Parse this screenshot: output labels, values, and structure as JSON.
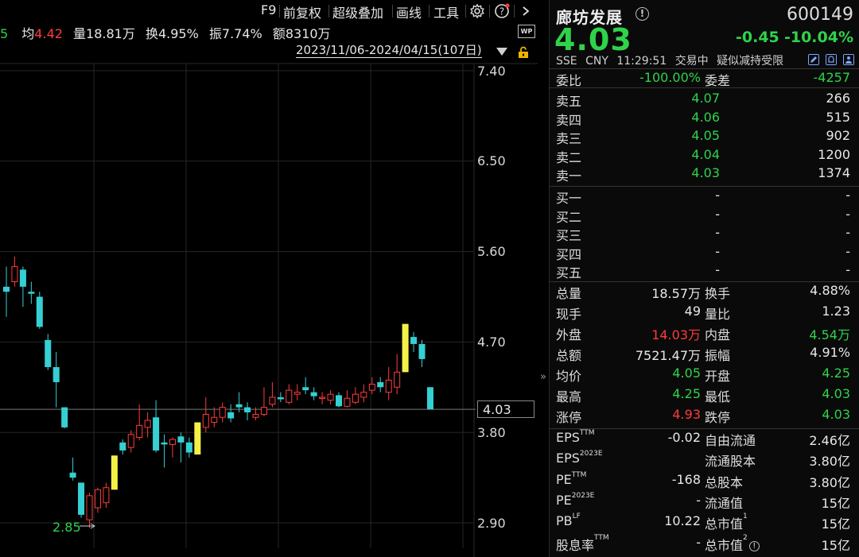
{
  "toolbar": {
    "f9": "F9",
    "fuquan": "前复权",
    "superimpose": "超级叠加",
    "drawing": "画线",
    "tools": "工具",
    "wp": "WP"
  },
  "stats": {
    "prefix": "5",
    "avg_label": "均",
    "avg_value": "4.42",
    "vol_label": "量",
    "vol_value": "18.81万",
    "turnover_label": "换",
    "turnover_value": "4.95%",
    "amplitude_label": "振",
    "amplitude_value": "7.74%",
    "amount_label": "额",
    "amount_value": "8310万"
  },
  "date_range": "2023/11/06-2024/04/15(107日)",
  "price_axis": [
    "7.40",
    "6.50",
    "5.60",
    "4.70",
    "3.80",
    "2.90"
  ],
  "last_price_tag": "4.03",
  "low_marker": "2.85",
  "collapse_glyph": "»",
  "colors": {
    "up": "#ff3b3b",
    "down": "#35d0d3",
    "limit_up": "#f4f247",
    "green": "#2fd34a",
    "background": "#000000"
  },
  "chart_data": {
    "type": "candlestick",
    "ylim": [
      2.78,
      7.55
    ],
    "grid": true,
    "candles": [
      {
        "o": 5.25,
        "c": 5.2,
        "h": 5.45,
        "l": 4.95,
        "k": "down"
      },
      {
        "o": 5.3,
        "c": 5.45,
        "h": 5.55,
        "l": 5.25,
        "k": "up"
      },
      {
        "o": 5.42,
        "c": 5.25,
        "h": 5.45,
        "l": 5.05,
        "k": "down"
      },
      {
        "o": 5.2,
        "c": 5.18,
        "h": 5.3,
        "l": 5.08,
        "k": "down"
      },
      {
        "o": 5.15,
        "c": 4.85,
        "h": 5.2,
        "l": 4.83,
        "k": "down"
      },
      {
        "o": 4.72,
        "c": 4.45,
        "h": 4.78,
        "l": 4.42,
        "k": "down"
      },
      {
        "o": 4.45,
        "c": 4.3,
        "h": 4.6,
        "l": 4.05,
        "k": "down"
      },
      {
        "o": 4.05,
        "c": 3.85,
        "h": 4.05,
        "l": 3.84,
        "k": "down"
      },
      {
        "o": 3.4,
        "c": 3.35,
        "h": 3.55,
        "l": 3.32,
        "k": "down"
      },
      {
        "o": 3.3,
        "c": 2.98,
        "h": 3.3,
        "l": 2.95,
        "k": "down"
      },
      {
        "o": 2.93,
        "c": 3.17,
        "h": 3.2,
        "l": 2.85,
        "k": "up"
      },
      {
        "o": 3.05,
        "c": 3.23,
        "h": 3.25,
        "l": 3.0,
        "k": "up"
      },
      {
        "o": 3.1,
        "c": 3.25,
        "h": 3.3,
        "l": 3.05,
        "k": "up"
      },
      {
        "o": 3.23,
        "c": 3.57,
        "h": 3.57,
        "l": 3.23,
        "k": "limit_up"
      },
      {
        "o": 3.7,
        "c": 3.62,
        "h": 3.73,
        "l": 3.58,
        "k": "down"
      },
      {
        "o": 3.65,
        "c": 3.78,
        "h": 3.82,
        "l": 3.6,
        "k": "up"
      },
      {
        "o": 3.75,
        "c": 3.87,
        "h": 4.08,
        "l": 3.72,
        "k": "up"
      },
      {
        "o": 3.85,
        "c": 3.92,
        "h": 4.0,
        "l": 3.75,
        "k": "up"
      },
      {
        "o": 3.95,
        "c": 3.62,
        "h": 4.12,
        "l": 3.6,
        "k": "down"
      },
      {
        "o": 3.7,
        "c": 3.68,
        "h": 3.78,
        "l": 3.45,
        "k": "down"
      },
      {
        "o": 3.68,
        "c": 3.73,
        "h": 3.75,
        "l": 3.55,
        "k": "up"
      },
      {
        "o": 3.76,
        "c": 3.7,
        "h": 3.8,
        "l": 3.5,
        "k": "down"
      },
      {
        "o": 3.7,
        "c": 3.6,
        "h": 3.75,
        "l": 3.55,
        "k": "down"
      },
      {
        "o": 3.58,
        "c": 3.9,
        "h": 3.9,
        "l": 3.58,
        "k": "limit_up"
      },
      {
        "o": 3.85,
        "c": 3.98,
        "h": 4.15,
        "l": 3.8,
        "k": "up"
      },
      {
        "o": 3.9,
        "c": 3.95,
        "h": 4.05,
        "l": 3.85,
        "k": "up"
      },
      {
        "o": 3.95,
        "c": 4.05,
        "h": 4.1,
        "l": 3.9,
        "k": "up"
      },
      {
        "o": 4.0,
        "c": 3.94,
        "h": 4.08,
        "l": 3.9,
        "k": "down"
      },
      {
        "o": 4.05,
        "c": 4.08,
        "h": 4.2,
        "l": 4.0,
        "k": "down"
      },
      {
        "o": 4.05,
        "c": 4.0,
        "h": 4.1,
        "l": 3.92,
        "k": "down"
      },
      {
        "o": 3.95,
        "c": 3.98,
        "h": 4.05,
        "l": 3.92,
        "k": "up"
      },
      {
        "o": 3.98,
        "c": 4.05,
        "h": 4.25,
        "l": 3.96,
        "k": "up"
      },
      {
        "o": 4.08,
        "c": 4.15,
        "h": 4.3,
        "l": 4.05,
        "k": "up"
      },
      {
        "o": 4.13,
        "c": 4.15,
        "h": 4.2,
        "l": 4.1,
        "k": "down"
      },
      {
        "o": 4.1,
        "c": 4.22,
        "h": 4.28,
        "l": 4.08,
        "k": "up"
      },
      {
        "o": 4.18,
        "c": 4.2,
        "h": 4.28,
        "l": 4.12,
        "k": "up"
      },
      {
        "o": 4.25,
        "c": 4.22,
        "h": 4.35,
        "l": 4.18,
        "k": "down"
      },
      {
        "o": 4.2,
        "c": 4.16,
        "h": 4.25,
        "l": 4.12,
        "k": "down"
      },
      {
        "o": 4.15,
        "c": 4.15,
        "h": 4.2,
        "l": 4.08,
        "k": "up"
      },
      {
        "o": 4.12,
        "c": 4.18,
        "h": 4.22,
        "l": 4.08,
        "k": "up"
      },
      {
        "o": 4.17,
        "c": 4.06,
        "h": 4.2,
        "l": 4.05,
        "k": "down"
      },
      {
        "o": 4.06,
        "c": 4.14,
        "h": 4.22,
        "l": 4.05,
        "k": "up"
      },
      {
        "o": 4.1,
        "c": 4.18,
        "h": 4.25,
        "l": 4.08,
        "k": "up"
      },
      {
        "o": 4.15,
        "c": 4.2,
        "h": 4.28,
        "l": 4.1,
        "k": "up"
      },
      {
        "o": 4.22,
        "c": 4.28,
        "h": 4.35,
        "l": 4.18,
        "k": "up"
      },
      {
        "o": 4.3,
        "c": 4.25,
        "h": 4.35,
        "l": 4.2,
        "k": "down"
      },
      {
        "o": 4.2,
        "c": 4.32,
        "h": 4.45,
        "l": 4.12,
        "k": "up"
      },
      {
        "o": 4.25,
        "c": 4.4,
        "h": 4.58,
        "l": 4.18,
        "k": "up"
      },
      {
        "o": 4.4,
        "c": 4.88,
        "h": 4.88,
        "l": 4.4,
        "k": "limit_up"
      },
      {
        "o": 4.75,
        "c": 4.68,
        "h": 4.8,
        "l": 4.6,
        "k": "down"
      },
      {
        "o": 4.68,
        "c": 4.53,
        "h": 4.72,
        "l": 4.45,
        "k": "down"
      },
      {
        "o": 4.25,
        "c": 4.03,
        "h": 4.25,
        "l": 4.03,
        "k": "down"
      }
    ]
  },
  "quote": {
    "name": "廊坊发展",
    "code": "600149",
    "price": "4.03",
    "change": "-0.45",
    "change_pct": "-10.04%",
    "exchange": "SSE",
    "currency": "CNY",
    "time": "11:29:51",
    "status": "交易中",
    "risk_note": "疑似减持受限",
    "weibi_label": "委比",
    "weibi_value": "-100.00%",
    "weicha_label": "委差",
    "weicha_value": "-4257",
    "asks": [
      {
        "label": "卖五",
        "price": "4.07",
        "vol": "266"
      },
      {
        "label": "卖四",
        "price": "4.06",
        "vol": "515"
      },
      {
        "label": "卖三",
        "price": "4.05",
        "vol": "902"
      },
      {
        "label": "卖二",
        "price": "4.04",
        "vol": "1200"
      },
      {
        "label": "卖一",
        "price": "4.03",
        "vol": "1374"
      }
    ],
    "bids": [
      {
        "label": "买一",
        "price": "-",
        "vol": "-"
      },
      {
        "label": "买二",
        "price": "-",
        "vol": "-"
      },
      {
        "label": "买三",
        "price": "-",
        "vol": "-"
      },
      {
        "label": "买四",
        "price": "-",
        "vol": "-"
      },
      {
        "label": "买五",
        "price": "-",
        "vol": "-"
      }
    ],
    "stats": [
      {
        "l1": "总量",
        "v1": "18.57万",
        "c1": "white",
        "l2": "换手",
        "v2": "4.88%",
        "c2": "white"
      },
      {
        "l1": "现手",
        "v1": "49",
        "c1": "white",
        "l2": "量比",
        "v2": "1.23",
        "c2": "white"
      },
      {
        "l1": "外盘",
        "v1": "14.03万",
        "c1": "red",
        "l2": "内盘",
        "v2": "4.54万",
        "c2": "green"
      },
      {
        "l1": "总额",
        "v1": "7521.47万",
        "c1": "white",
        "l2": "振幅",
        "v2": "4.91%",
        "c2": "white"
      },
      {
        "l1": "均价",
        "v1": "4.05",
        "c1": "green",
        "l2": "开盘",
        "v2": "4.25",
        "c2": "green"
      },
      {
        "l1": "最高",
        "v1": "4.25",
        "c1": "green",
        "l2": "最低",
        "v2": "4.03",
        "c2": "green"
      },
      {
        "l1": "涨停",
        "v1": "4.93",
        "c1": "red",
        "l2": "跌停",
        "v2": "4.03",
        "c2": "green"
      }
    ],
    "fundamentals": [
      {
        "l1": "EPS",
        "sup1": "TTM",
        "v1": "-0.02",
        "l2": "自由流通",
        "sup2": "",
        "v2": "2.46亿"
      },
      {
        "l1": "EPS",
        "sup1": "2023E",
        "v1": "",
        "l2": "流通股本",
        "sup2": "",
        "v2": "3.80亿"
      },
      {
        "l1": "PE",
        "sup1": "TTM",
        "v1": "-168",
        "l2": "总股本",
        "sup2": "",
        "v2": "3.80亿"
      },
      {
        "l1": "PE",
        "sup1": "2023E",
        "v1": "-",
        "l2": "流通值",
        "sup2": "",
        "v2": "15亿"
      },
      {
        "l1": "PB",
        "sup1": "LF",
        "v1": "10.22",
        "l2": "总市值",
        "sup2": "1",
        "v2": "15亿"
      },
      {
        "l1": "股息率",
        "sup1": "TTM",
        "v1": "-",
        "l2": "总市值",
        "sup2": "2",
        "v2": "15亿"
      }
    ]
  }
}
